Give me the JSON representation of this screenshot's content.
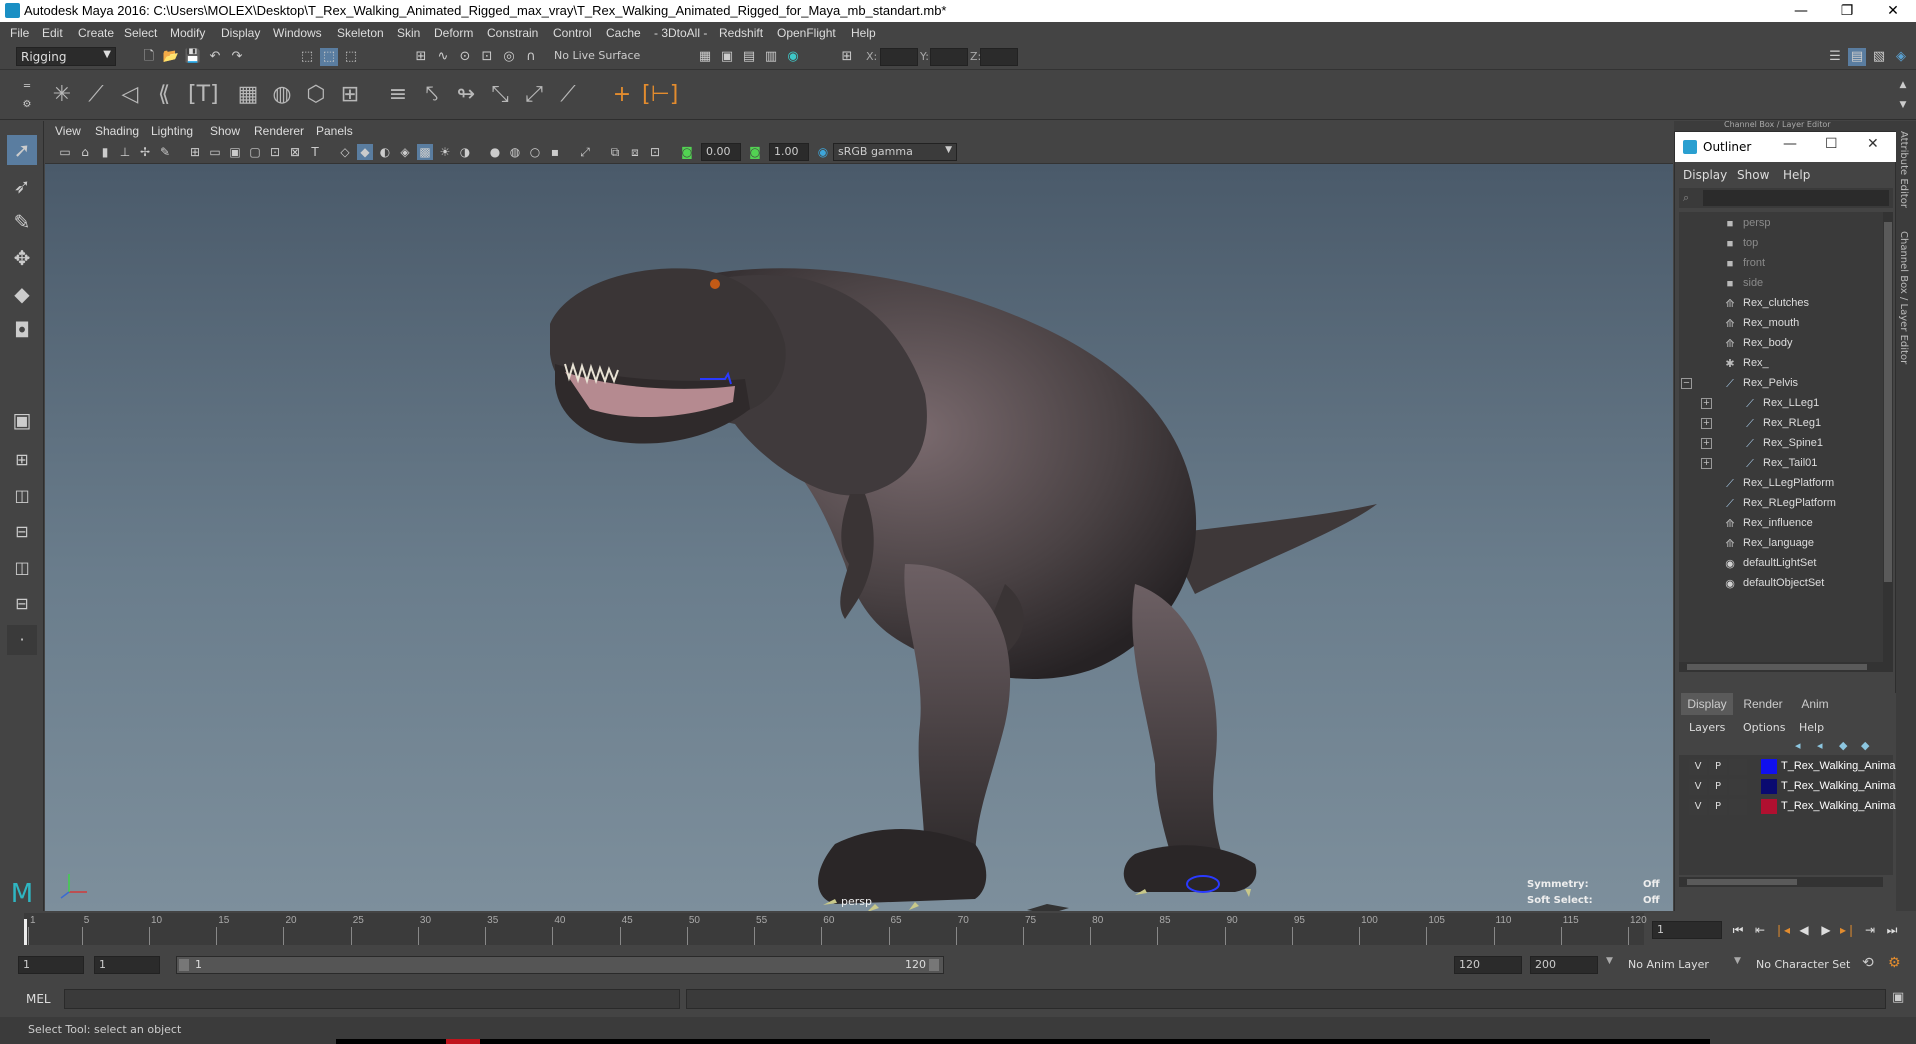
{
  "window": {
    "title": "Autodesk Maya 2016: C:\\Users\\MOLEX\\Desktop\\T_Rex_Walking_Animated_Rigged_max_vray\\T_Rex_Walking_Animated_Rigged_for_Maya_mb_standart.mb*",
    "minimize": "—",
    "restore": "❐",
    "close": "✕"
  },
  "menubar": [
    "File",
    "Edit",
    "Create",
    "Select",
    "Modify",
    "Display",
    "Windows",
    "Skeleton",
    "Skin",
    "Deform",
    "Constrain",
    "Control",
    "Cache",
    "- 3DtoAll -",
    "Redshift",
    "OpenFlight",
    "Help"
  ],
  "statusline": {
    "mode": "Rigging",
    "live_surface": "No Live Surface",
    "x_label": "X:",
    "y_label": "Y:",
    "z_label": "Z:"
  },
  "viewport": {
    "menu": [
      "View",
      "Shading",
      "Lighting",
      "Show",
      "Renderer",
      "Panels"
    ],
    "exposure": "0.00",
    "gamma": "1.00",
    "color_space": "sRGB gamma",
    "camera_label": "persp",
    "symmetry_label": "Symmetry:",
    "symmetry_value": "Off",
    "soft_select_label": "Soft Select:",
    "soft_select_value": "Off"
  },
  "outliner": {
    "title": "Outliner",
    "panel_header": "Channel Box / Layer Editor",
    "menu": [
      "Display",
      "Show",
      "Help"
    ],
    "items": [
      {
        "label": "persp",
        "icon": "camera-icon",
        "indent": 0,
        "dim": true,
        "expander": ""
      },
      {
        "label": "top",
        "icon": "camera-icon",
        "indent": 0,
        "dim": true,
        "expander": ""
      },
      {
        "label": "front",
        "icon": "camera-icon",
        "indent": 0,
        "dim": true,
        "expander": ""
      },
      {
        "label": "side",
        "icon": "camera-icon",
        "indent": 0,
        "dim": true,
        "expander": ""
      },
      {
        "label": "Rex_clutches",
        "icon": "mesh-icon",
        "indent": 0,
        "dim": false,
        "expander": ""
      },
      {
        "label": "Rex_mouth",
        "icon": "mesh-icon",
        "indent": 0,
        "dim": false,
        "expander": ""
      },
      {
        "label": "Rex_body",
        "icon": "mesh-icon",
        "indent": 0,
        "dim": false,
        "expander": ""
      },
      {
        "label": "Rex_",
        "icon": "locator-icon",
        "indent": 0,
        "dim": false,
        "expander": ""
      },
      {
        "label": "Rex_Pelvis",
        "icon": "joint-icon",
        "indent": 0,
        "dim": false,
        "expander": "−"
      },
      {
        "label": "Rex_LLeg1",
        "icon": "joint-icon",
        "indent": 1,
        "dim": false,
        "expander": "+"
      },
      {
        "label": "Rex_RLeg1",
        "icon": "joint-icon",
        "indent": 1,
        "dim": false,
        "expander": "+"
      },
      {
        "label": "Rex_Spine1",
        "icon": "joint-icon",
        "indent": 1,
        "dim": false,
        "expander": "+"
      },
      {
        "label": "Rex_Tail01",
        "icon": "joint-icon",
        "indent": 1,
        "dim": false,
        "expander": "+"
      },
      {
        "label": "Rex_LLegPlatform",
        "icon": "joint-icon",
        "indent": 0,
        "dim": false,
        "expander": ""
      },
      {
        "label": "Rex_RLegPlatform",
        "icon": "joint-icon",
        "indent": 0,
        "dim": false,
        "expander": ""
      },
      {
        "label": "Rex_influence",
        "icon": "mesh-icon",
        "indent": 0,
        "dim": false,
        "expander": ""
      },
      {
        "label": "Rex_language",
        "icon": "mesh-icon",
        "indent": 0,
        "dim": false,
        "expander": ""
      },
      {
        "label": "defaultLightSet",
        "icon": "set-icon",
        "indent": 0,
        "dim": false,
        "expander": ""
      },
      {
        "label": "defaultObjectSet",
        "icon": "set-icon",
        "indent": 0,
        "dim": false,
        "expander": ""
      }
    ]
  },
  "layers": {
    "tabs": [
      "Display",
      "Render",
      "Anim"
    ],
    "menu": [
      "Layers",
      "Options",
      "Help"
    ],
    "rows": [
      {
        "v": "V",
        "p": "P",
        "color": "#1010ee",
        "name": "T_Rex_Walking_Anima"
      },
      {
        "v": "V",
        "p": "P",
        "color": "#0a0a70",
        "name": "T_Rex_Walking_Anima"
      },
      {
        "v": "V",
        "p": "P",
        "color": "#b01030",
        "name": "T_Rex_Walking_Anima"
      }
    ]
  },
  "side_tabs": [
    "Attribute Editor",
    "Channel Box / Layer Editor"
  ],
  "timeline": {
    "ticks": [
      "1",
      "5",
      "10",
      "15",
      "20",
      "25",
      "30",
      "35",
      "40",
      "45",
      "50",
      "55",
      "60",
      "65",
      "70",
      "75",
      "80",
      "85",
      "90",
      "95",
      "100",
      "105",
      "110",
      "115",
      "120"
    ],
    "current_frame": "1"
  },
  "range": {
    "start": "1",
    "anim_start": "1",
    "slider_start": "1",
    "slider_end": "120",
    "anim_end": "120",
    "end": "200",
    "anim_layer": "No Anim Layer",
    "character_set": "No Character Set"
  },
  "cmdline": {
    "label": "MEL"
  },
  "helpline": {
    "text": "Select Tool: select an object"
  }
}
